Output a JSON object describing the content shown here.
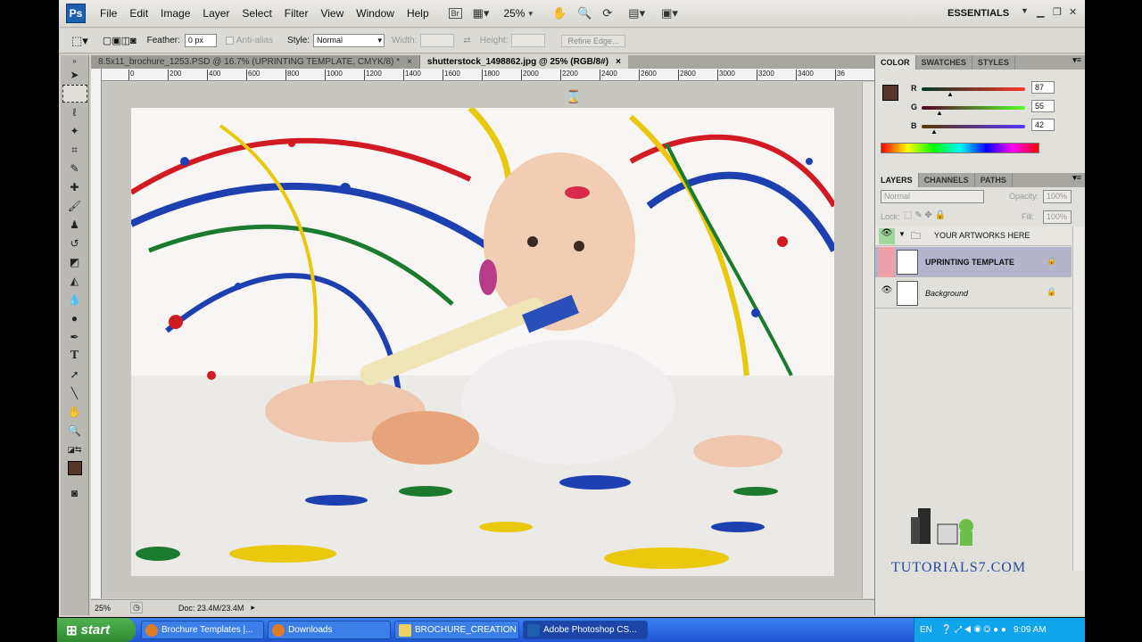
{
  "menu": {
    "logo": "Ps",
    "items": [
      "File",
      "Edit",
      "Image",
      "Layer",
      "Select",
      "Filter",
      "View",
      "Window",
      "Help"
    ],
    "zoom": "25%",
    "workspace": "ESSENTIALS",
    "icons": [
      "bridge-icon",
      "screen-mode-icon",
      "hand-icon",
      "zoom-icon",
      "rotate-view-icon",
      "arrange-icon",
      "screen-size-icon"
    ]
  },
  "options": {
    "feather_label": "Feather:",
    "feather_value": "0 px",
    "antialias_label": "Anti-alias",
    "style_label": "Style:",
    "style_value": "Normal",
    "width_label": "Width:",
    "height_label": "Height:",
    "refine_label": "Refine Edge..."
  },
  "tabs": [
    {
      "label": "8.5x11_brochure_1253.PSD @ 16.7% (UPRINTING TEMPLATE, CMYK/8) *",
      "active": false
    },
    {
      "label": "shutterstock_1498862.jpg @ 25% (RGB/8#)",
      "active": true
    }
  ],
  "ruler": [
    "0",
    "200",
    "400",
    "600",
    "800",
    "1000",
    "1200",
    "1400",
    "1600",
    "1800",
    "2000",
    "2200",
    "2400",
    "2600",
    "2800",
    "3000",
    "3200",
    "3400",
    "36"
  ],
  "status": {
    "zoom": "25%",
    "doc": "Doc: 23.4M/23.4M"
  },
  "color_panel": {
    "tabs": [
      "COLOR",
      "SWATCHES",
      "STYLES"
    ],
    "r_label": "R",
    "r_value": "87",
    "g_label": "G",
    "g_value": "55",
    "b_label": "B",
    "b_value": "42",
    "fg_color": "#573729"
  },
  "layers_panel": {
    "tabs": [
      "LAYERS",
      "CHANNELS",
      "PATHS"
    ],
    "blend_mode": "Normal",
    "opacity_label": "Opacity:",
    "opacity_value": "100%",
    "lock_label": "Lock:",
    "fill_label": "Fill:",
    "fill_value": "100%",
    "group_name": "YOUR ARTWORKS HERE",
    "layers": [
      {
        "name": "UPRINTING TEMPLATE",
        "selected": true
      },
      {
        "name": "Background",
        "selected": false
      }
    ]
  },
  "watermark": "TUTORIALS7.COM",
  "taskbar": {
    "start": "start",
    "tasks": [
      "Brochure Templates |...",
      "Downloads",
      "BROCHURE_CREATION",
      "Adobe Photoshop CS..."
    ],
    "lang": "EN",
    "clock": "9:09 AM"
  }
}
